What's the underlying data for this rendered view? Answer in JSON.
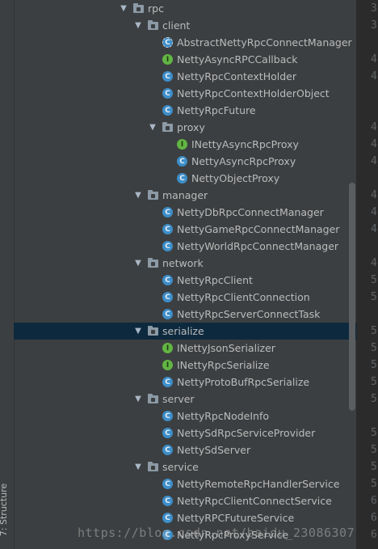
{
  "side_panel": {
    "label": "7: Structure"
  },
  "tree": [
    {
      "label": "rpc",
      "kind": "folder",
      "level": 0,
      "expanded": true
    },
    {
      "label": "client",
      "kind": "folder",
      "level": 1,
      "expanded": true
    },
    {
      "label": "AbstractNettyRpcConnectManager",
      "kind": "ac",
      "level": 2
    },
    {
      "label": "NettyAsyncRPCCallback",
      "kind": "i",
      "level": 2
    },
    {
      "label": "NettyRpcContextHolder",
      "kind": "c",
      "level": 2
    },
    {
      "label": "NettyRpcContextHolderObject",
      "kind": "c",
      "level": 2
    },
    {
      "label": "NettyRpcFuture",
      "kind": "c",
      "level": 2
    },
    {
      "label": "proxy",
      "kind": "folder",
      "level": 2,
      "expanded": true
    },
    {
      "label": "INettyAsyncRpcProxy",
      "kind": "i",
      "level": 3
    },
    {
      "label": "NettyAsyncRpcProxy",
      "kind": "c",
      "level": 3
    },
    {
      "label": "NettyObjectProxy",
      "kind": "c",
      "level": 3
    },
    {
      "label": "manager",
      "kind": "folder",
      "level": 1,
      "expanded": true
    },
    {
      "label": "NettyDbRpcConnectManager",
      "kind": "c",
      "level": 2
    },
    {
      "label": "NettyGameRpcConnectManager",
      "kind": "c",
      "level": 2
    },
    {
      "label": "NettyWorldRpcConnectManager",
      "kind": "c",
      "level": 2
    },
    {
      "label": "network",
      "kind": "folder",
      "level": 1,
      "expanded": true
    },
    {
      "label": "NettyRpcClient",
      "kind": "c",
      "level": 2
    },
    {
      "label": "NettyRpcClientConnection",
      "kind": "c",
      "level": 2
    },
    {
      "label": "NettyRpcServerConnectTask",
      "kind": "c",
      "level": 2
    },
    {
      "label": "serialize",
      "kind": "folder",
      "level": 1,
      "expanded": true,
      "selected": true
    },
    {
      "label": "INettyJsonSerializer",
      "kind": "i",
      "level": 2
    },
    {
      "label": "INettyRpcSerialize",
      "kind": "i",
      "level": 2
    },
    {
      "label": "NettyProtoBufRpcSerialize",
      "kind": "c",
      "level": 2
    },
    {
      "label": "server",
      "kind": "folder",
      "level": 1,
      "expanded": true
    },
    {
      "label": "NettyRpcNodeInfo",
      "kind": "c",
      "level": 2
    },
    {
      "label": "NettySdRpcServiceProvider",
      "kind": "c",
      "level": 2
    },
    {
      "label": "NettySdServer",
      "kind": "c",
      "level": 2
    },
    {
      "label": "service",
      "kind": "folder",
      "level": 1,
      "expanded": true
    },
    {
      "label": "NettyRemoteRpcHandlerService",
      "kind": "c",
      "level": 2
    },
    {
      "label": "NettyRpcClientConnectService",
      "kind": "c",
      "level": 2
    },
    {
      "label": "NettyRPCFutureService",
      "kind": "c",
      "level": 2
    },
    {
      "label": "NettyRpcProxyService",
      "kind": "c",
      "level": 2
    }
  ],
  "editor_gutter": [
    {
      "text": "3",
      "row": 0
    },
    {
      "text": "3",
      "row": 1
    },
    {
      "text": "4",
      "row": 3
    },
    {
      "text": "4",
      "row": 4
    },
    {
      "text": "4",
      "row": 7
    },
    {
      "text": "4",
      "row": 8
    },
    {
      "text": "4",
      "row": 9
    },
    {
      "text": "4",
      "row": 11
    },
    {
      "text": "4",
      "row": 12
    },
    {
      "text": "4",
      "row": 13
    },
    {
      "text": "4",
      "row": 15
    },
    {
      "text": "5",
      "row": 16
    },
    {
      "text": "5",
      "row": 17
    },
    {
      "text": "5",
      "row": 19
    },
    {
      "text": "5",
      "row": 20
    },
    {
      "text": "5",
      "row": 21
    },
    {
      "text": "5",
      "row": 22
    },
    {
      "text": "5",
      "row": 23
    },
    {
      "text": "5",
      "row": 25
    },
    {
      "text": "5",
      "row": 26
    },
    {
      "text": "5",
      "row": 27
    },
    {
      "text": "5",
      "row": 28
    },
    {
      "text": "6",
      "row": 29
    },
    {
      "text": "6",
      "row": 30
    },
    {
      "text": "6",
      "row": 31
    }
  ],
  "watermark": "https://blog.csdn.net/baidu_23086307"
}
